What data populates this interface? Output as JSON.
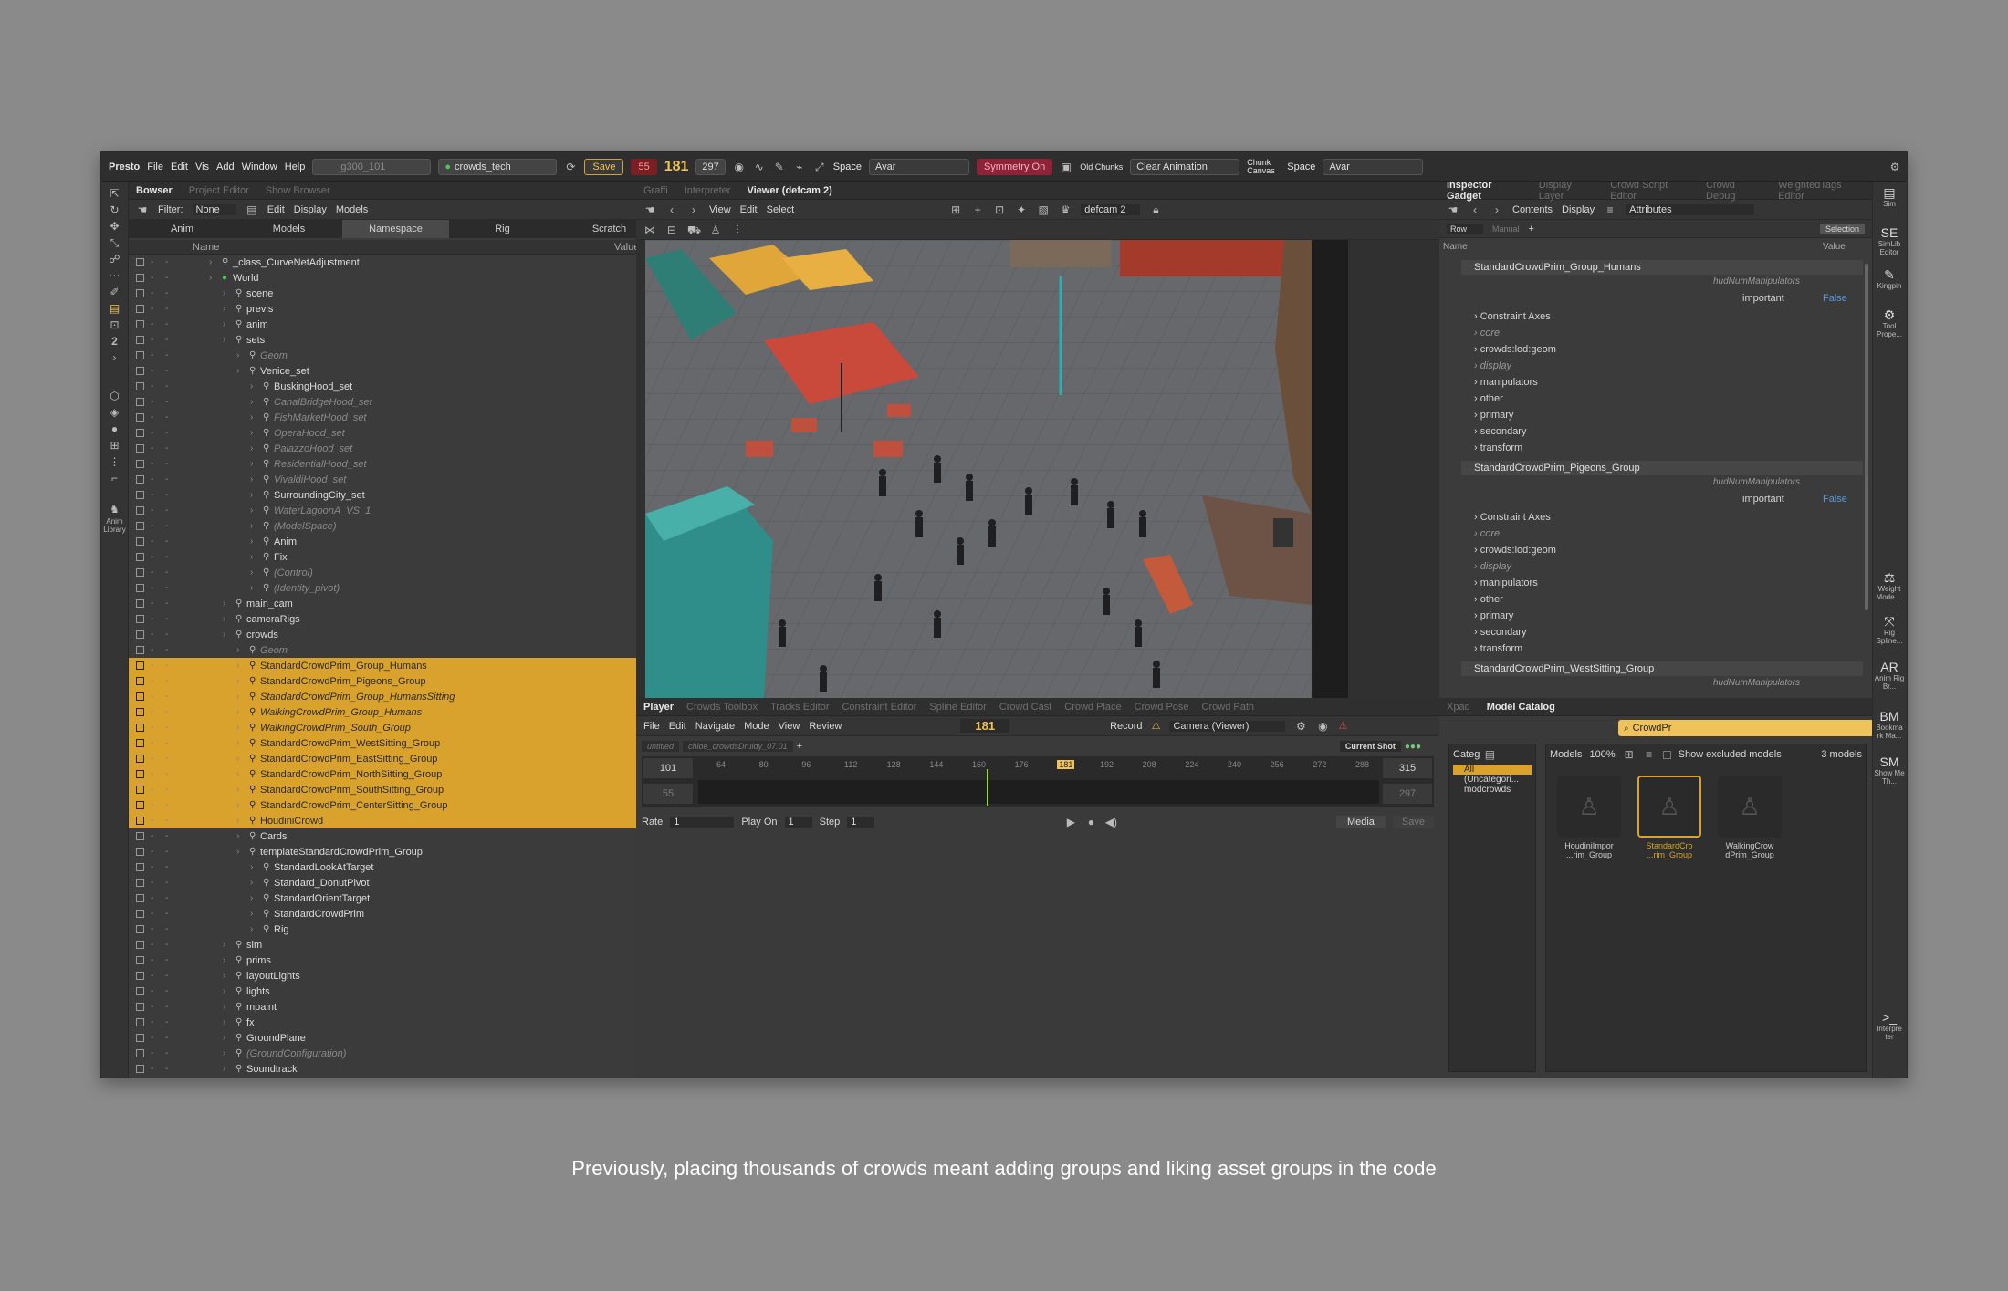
{
  "menu": {
    "app": "Presto",
    "items": [
      "File",
      "Edit",
      "Vis",
      "Add",
      "Window",
      "Help"
    ]
  },
  "topbar": {
    "asset": "g300_101",
    "project": "crowds_tech",
    "save": "Save",
    "frame_start": "55",
    "frame_current": "181",
    "frame_end": "297",
    "space1_label": "Space",
    "space1_value": "Avar",
    "symmetry": "Symmetry On",
    "old_chunks": "Old Chunks",
    "clear_anim": "Clear Animation",
    "chunk_canvas": "Chunk Canvas",
    "space2_label": "Space",
    "space2_value": "Avar"
  },
  "browser": {
    "tabs": [
      "Bowser",
      "Project Editor",
      "Show Browser"
    ],
    "filter_label": "Filter:",
    "filter_value": "None",
    "edit": "Edit",
    "display": "Display",
    "models": "Models",
    "segments": [
      "Anim",
      "Models",
      "Namespace",
      "Rig",
      "Scratch"
    ],
    "col_name": "Name",
    "col_value": "Value",
    "rows": [
      {
        "t": "_class_CurveNetAdjustment",
        "i": 0,
        "it": false,
        "s": false
      },
      {
        "t": "World",
        "i": 0,
        "it": false,
        "s": false
      },
      {
        "t": "scene",
        "i": 1,
        "it": false,
        "s": false
      },
      {
        "t": "previs",
        "i": 1,
        "it": false,
        "s": false
      },
      {
        "t": "anim",
        "i": 1,
        "it": false,
        "s": false
      },
      {
        "t": "sets",
        "i": 1,
        "it": false,
        "s": false
      },
      {
        "t": "Geom",
        "i": 2,
        "it": true,
        "s": false
      },
      {
        "t": "Venice_set",
        "i": 2,
        "it": false,
        "s": false
      },
      {
        "t": "BuskingHood_set",
        "i": 3,
        "it": false,
        "s": false
      },
      {
        "t": "CanalBridgeHood_set",
        "i": 3,
        "it": true,
        "s": false
      },
      {
        "t": "FishMarketHood_set",
        "i": 3,
        "it": true,
        "s": false
      },
      {
        "t": "OperaHood_set",
        "i": 3,
        "it": true,
        "s": false
      },
      {
        "t": "PalazzoHood_set",
        "i": 3,
        "it": true,
        "s": false
      },
      {
        "t": "ResidentialHood_set",
        "i": 3,
        "it": true,
        "s": false
      },
      {
        "t": "VivaldiHood_set",
        "i": 3,
        "it": true,
        "s": false
      },
      {
        "t": "SurroundingCity_set",
        "i": 3,
        "it": false,
        "s": false
      },
      {
        "t": "WaterLagoonA_VS_1",
        "i": 3,
        "it": true,
        "s": false
      },
      {
        "t": "(ModelSpace)",
        "i": 3,
        "it": true,
        "s": false
      },
      {
        "t": "Anim",
        "i": 3,
        "it": false,
        "s": false
      },
      {
        "t": "Fix",
        "i": 3,
        "it": false,
        "s": false
      },
      {
        "t": "(Control)",
        "i": 3,
        "it": true,
        "s": false
      },
      {
        "t": "(Identity_pivot)",
        "i": 3,
        "it": true,
        "s": false
      },
      {
        "t": "main_cam",
        "i": 1,
        "it": false,
        "s": false
      },
      {
        "t": "cameraRigs",
        "i": 1,
        "it": false,
        "s": false
      },
      {
        "t": "crowds",
        "i": 1,
        "it": false,
        "s": false
      },
      {
        "t": "Geom",
        "i": 2,
        "it": true,
        "s": false
      },
      {
        "t": "StandardCrowdPrim_Group_Humans",
        "i": 2,
        "it": false,
        "s": true
      },
      {
        "t": "StandardCrowdPrim_Pigeons_Group",
        "i": 2,
        "it": false,
        "s": true
      },
      {
        "t": "StandardCrowdPrim_Group_HumansSitting",
        "i": 2,
        "it": true,
        "s": true
      },
      {
        "t": "WalkingCrowdPrim_Group_Humans",
        "i": 2,
        "it": true,
        "s": true
      },
      {
        "t": "WalkingCrowdPrim_South_Group",
        "i": 2,
        "it": true,
        "s": true
      },
      {
        "t": "StandardCrowdPrim_WestSitting_Group",
        "i": 2,
        "it": false,
        "s": true
      },
      {
        "t": "StandardCrowdPrim_EastSitting_Group",
        "i": 2,
        "it": false,
        "s": true
      },
      {
        "t": "StandardCrowdPrim_NorthSitting_Group",
        "i": 2,
        "it": false,
        "s": true
      },
      {
        "t": "StandardCrowdPrim_SouthSitting_Group",
        "i": 2,
        "it": false,
        "s": true
      },
      {
        "t": "StandardCrowdPrim_CenterSitting_Group",
        "i": 2,
        "it": false,
        "s": true
      },
      {
        "t": "HoudiniCrowd",
        "i": 2,
        "it": false,
        "s": true
      },
      {
        "t": "Cards",
        "i": 2,
        "it": false,
        "s": false
      },
      {
        "t": "templateStandardCrowdPrim_Group",
        "i": 2,
        "it": false,
        "s": false
      },
      {
        "t": "StandardLookAtTarget",
        "i": 3,
        "it": false,
        "s": false
      },
      {
        "t": "Standard_DonutPivot",
        "i": 3,
        "it": false,
        "s": false
      },
      {
        "t": "StandardOrientTarget",
        "i": 3,
        "it": false,
        "s": false
      },
      {
        "t": "StandardCrowdPrim",
        "i": 3,
        "it": false,
        "s": false
      },
      {
        "t": "Rig",
        "i": 3,
        "it": false,
        "s": false
      },
      {
        "t": "sim",
        "i": 1,
        "it": false,
        "s": false
      },
      {
        "t": "prims",
        "i": 1,
        "it": false,
        "s": false
      },
      {
        "t": "layoutLights",
        "i": 1,
        "it": false,
        "s": false
      },
      {
        "t": "lights",
        "i": 1,
        "it": false,
        "s": false
      },
      {
        "t": "mpaint",
        "i": 1,
        "it": false,
        "s": false
      },
      {
        "t": "fx",
        "i": 1,
        "it": false,
        "s": false
      },
      {
        "t": "GroundPlane",
        "i": 1,
        "it": false,
        "s": false
      },
      {
        "t": "(GroundConfiguration)",
        "i": 1,
        "it": true,
        "s": false
      },
      {
        "t": "Soundtrack",
        "i": 1,
        "it": false,
        "s": false
      }
    ]
  },
  "viewer": {
    "tabs": [
      "Graffi",
      "Interpreter",
      "Viewer (defcam 2)"
    ],
    "menu": [
      "View",
      "Edit",
      "Select"
    ],
    "camera": "defcam 2"
  },
  "player": {
    "tabs": [
      "Player",
      "Crowds Toolbox",
      "Tracks Editor",
      "Constraint Editor",
      "Spline Editor",
      "Crowd Cast",
      "Crowd Place",
      "Crowd Pose",
      "Crowd Path"
    ],
    "menu": [
      "File",
      "Edit",
      "Navigate",
      "Mode",
      "View",
      "Review"
    ],
    "frame": "181",
    "record": "Record",
    "camera": "Camera (Viewer)",
    "shot_tabs": [
      "untitled",
      "chloe_crowdsDruidy_07.01"
    ],
    "current_shot": "Current Shot",
    "range_start": "101",
    "range_start2": "55",
    "range_end": "315",
    "range_end2": "297",
    "ticks": [
      "64",
      "80",
      "96",
      "112",
      "128",
      "144",
      "160",
      "176",
      "181",
      "192",
      "208",
      "224",
      "240",
      "256",
      "272",
      "288"
    ],
    "rate_label": "Rate",
    "rate": "1",
    "playon_label": "Play On",
    "playon": "1",
    "step_label": "Step",
    "step": "1",
    "media": "Media",
    "save": "Save"
  },
  "inspector": {
    "tabs": [
      "Inspector Gadget",
      "Display Layer",
      "Crowd Script Editor",
      "Crowd Debug",
      "WeightedTags Editor"
    ],
    "contents": "Contents",
    "display": "Display",
    "attributes": "Attributes",
    "row": "Row",
    "manual": "Manual",
    "selection": "Selection",
    "col_name": "Name",
    "col_value": "Value",
    "groups": [
      {
        "name": "StandardCrowdPrim_Group_Humans",
        "hud": "hudNumManipulators",
        "imp_label": "important",
        "imp_value": "False",
        "items": [
          "Constraint Axes",
          "core",
          "crowds:lod:geom",
          "display",
          "manipulators",
          "other",
          "primary",
          "secondary",
          "transform"
        ]
      },
      {
        "name": "StandardCrowdPrim_Pigeons_Group",
        "hud": "hudNumManipulators",
        "imp_label": "important",
        "imp_value": "False",
        "items": [
          "Constraint Axes",
          "core",
          "crowds:lod:geom",
          "display",
          "manipulators",
          "other",
          "primary",
          "secondary",
          "transform"
        ]
      },
      {
        "name": "StandardCrowdPrim_WestSitting_Group",
        "hud": "hudNumManipulators"
      }
    ]
  },
  "catalog": {
    "tabs": [
      "Xpad",
      "Model Catalog"
    ],
    "search": "CrowdPr",
    "cat_label": "Categ",
    "cats": [
      "All",
      "(Uncategori...",
      "modcrowds"
    ],
    "models_label": "Models",
    "zoom": "100%",
    "show_excluded": "Show excluded models",
    "count": "3 models",
    "models": [
      {
        "name": "HoudiniImpor ...rim_Group",
        "sel": false
      },
      {
        "name": "StandardCro ...rim_Group",
        "sel": true
      },
      {
        "name": "WalkingCrow dPrim_Group",
        "sel": false
      }
    ]
  },
  "sidebar": [
    {
      "g": "▤",
      "l": "Sim"
    },
    {
      "g": "SE",
      "l": "SimLib Editor"
    },
    {
      "g": "✎",
      "l": "Kingpin"
    },
    {
      "g": "⚙",
      "l": "Tool Prope..."
    },
    {
      "g": "⚖",
      "l": "Weight Mode ..."
    },
    {
      "g": "⤧",
      "l": "Rig Spline..."
    },
    {
      "g": "AR",
      "l": "Anim Rig Br..."
    },
    {
      "g": "BM",
      "l": "Bookma rk Ma..."
    },
    {
      "g": "SM",
      "l": "Show Me Th..."
    },
    {
      "g": ">_",
      "l": "Interpre ter"
    }
  ],
  "left_tools": {
    "anim_library": "Anim Library"
  },
  "caption": "Previously, placing thousands of crowds meant adding groups and liking asset groups in the code"
}
